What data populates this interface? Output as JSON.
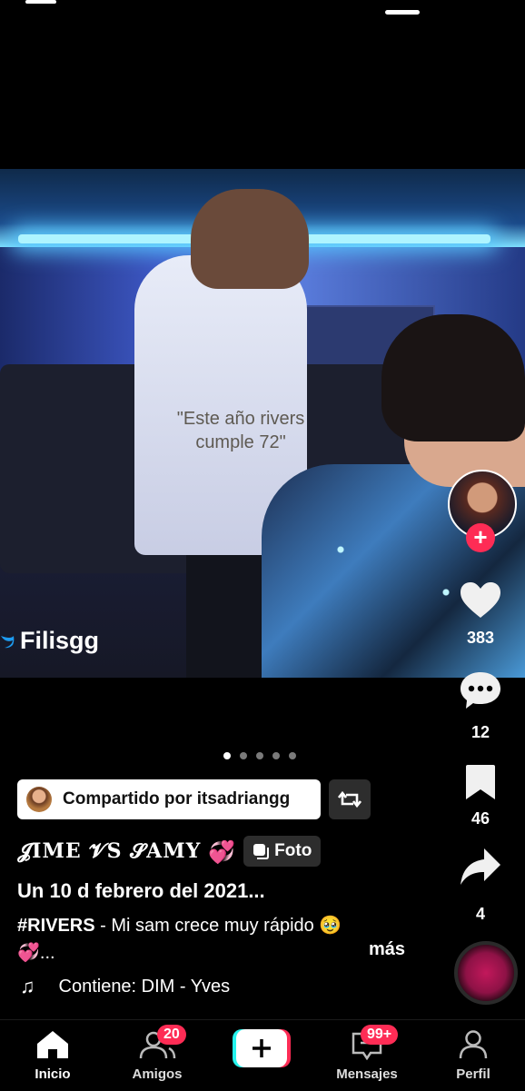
{
  "post": {
    "overlay_caption": "\"Este año rivers cumple 72\"",
    "watermark": "Filisgg",
    "carousel": {
      "count": 5,
      "active_index": 0
    },
    "shared_by": "Compartido por itsadriangg",
    "author": "𝓙IME 𝓥S 𝓢AMY",
    "author_hearts": "💞",
    "type_badge": "Foto",
    "title": "Un 10 d febrero del 2021...",
    "hashtag": "#RIVERS",
    "description": " - Mi sam crece muy rápido 🥹",
    "description_line2": "💞...",
    "more": "más",
    "music": "Contiene: DIM - Yves"
  },
  "actions": {
    "likes": "383",
    "comments": "12",
    "saves": "46",
    "shares": "4"
  },
  "nav": {
    "items": [
      {
        "label": "Inicio",
        "icon": "home-icon",
        "active": true
      },
      {
        "label": "Amigos",
        "icon": "friends-icon",
        "badge": "20"
      },
      {
        "label": "",
        "icon": "create-icon"
      },
      {
        "label": "Mensajes",
        "icon": "inbox-icon",
        "badge": "99+"
      },
      {
        "label": "Perfil",
        "icon": "profile-icon"
      }
    ]
  },
  "colors": {
    "accent": "#fe2c55",
    "create_cyan": "#25f4ee"
  }
}
